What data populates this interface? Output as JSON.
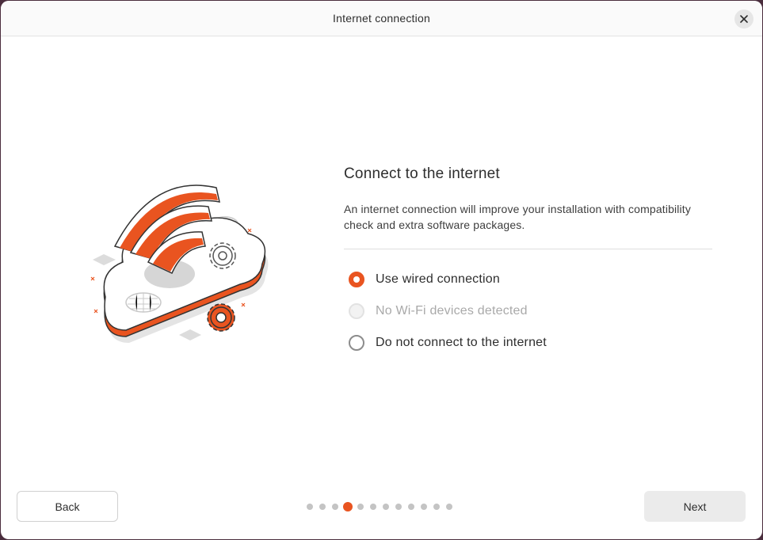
{
  "window": {
    "title": "Internet connection",
    "close_icon": "close-icon"
  },
  "main": {
    "heading": "Connect to the internet",
    "description": "An internet connection will improve your installation with compatibility check and extra software packages.",
    "options": [
      {
        "label": "Use wired connection",
        "selected": true,
        "disabled": false
      },
      {
        "label": "No Wi-Fi devices detected",
        "selected": false,
        "disabled": true
      },
      {
        "label": "Do not connect to the internet",
        "selected": false,
        "disabled": false
      }
    ]
  },
  "footer": {
    "back_label": "Back",
    "next_label": "Next",
    "progress": {
      "total_steps": 12,
      "current_step": 4
    }
  },
  "colors": {
    "accent": "#e95420",
    "disabled_text": "#a9a9a9"
  },
  "illustration_icon": "cloud-wifi-illustration"
}
